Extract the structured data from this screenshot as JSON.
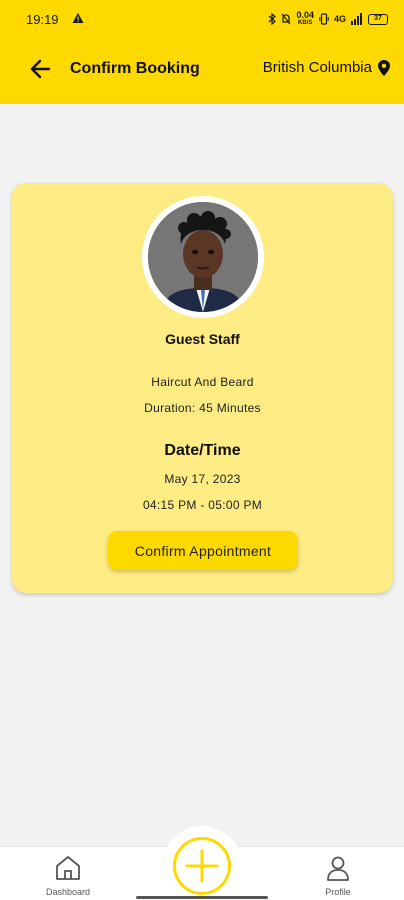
{
  "status_bar": {
    "time": "19:19",
    "speed_line1": "0.04",
    "speed_line2": "KB/S",
    "network": "4G",
    "battery": "37"
  },
  "header": {
    "title": "Confirm Booking",
    "location": "British Columbia"
  },
  "booking": {
    "staff_name": "Guest Staff",
    "service": "Haircut And Beard",
    "duration": "Duration: 45 Minutes",
    "datetime_heading": "Date/Time",
    "date": "May 17, 2023",
    "time_range": "04:15 PM - 05:00 PM",
    "confirm_label": "Confirm Appointment"
  },
  "bottom_nav": {
    "dashboard_label": "Dashboard",
    "profile_label": "Profile"
  },
  "colors": {
    "accent": "#fdd900",
    "card_bg": "#fdec83",
    "page_bg": "#f2f2f2"
  }
}
